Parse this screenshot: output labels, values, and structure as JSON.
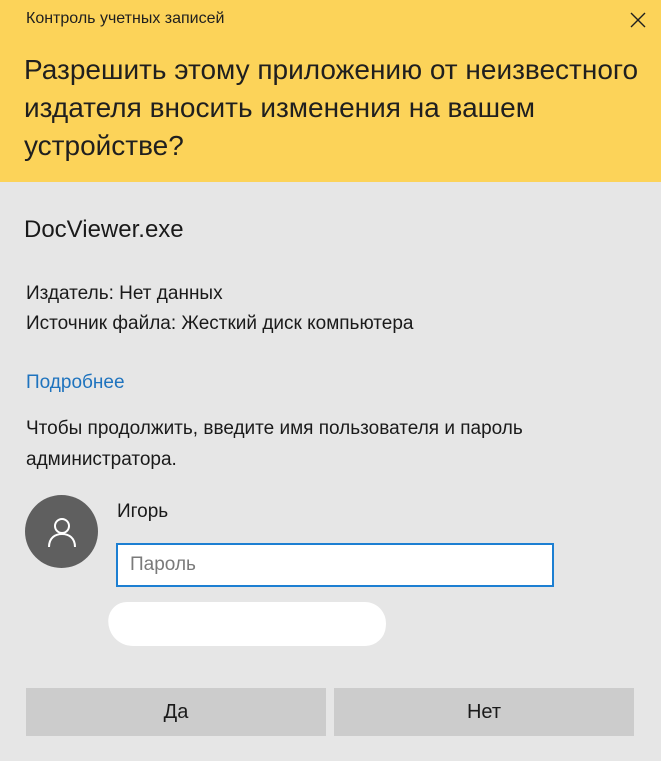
{
  "window": {
    "title": "Контроль учетных записей"
  },
  "header": {
    "question": "Разрешить этому приложению от неизвестного издателя вносить изменения на вашем устройстве?",
    "background_color": "#fcd359"
  },
  "app": {
    "name": "DocViewer.exe",
    "publisher": "Издатель: Нет данных",
    "source": "Источник файла: Жесткий диск компьютера"
  },
  "details_link": "Подробнее",
  "instructions": "Чтобы продолжить, введите имя пользователя и пароль администратора.",
  "account": {
    "username": "Игорь",
    "avatar_icon": "user-icon",
    "password_placeholder": "Пароль",
    "password_value": ""
  },
  "buttons": {
    "yes_label": "Да",
    "no_label": "Нет"
  },
  "icons": {
    "close": "close-icon"
  },
  "colors": {
    "accent": "#1d7fd2",
    "link": "#1e73be",
    "button_bg": "#cccccc",
    "body_bg": "#e6e6e6"
  }
}
